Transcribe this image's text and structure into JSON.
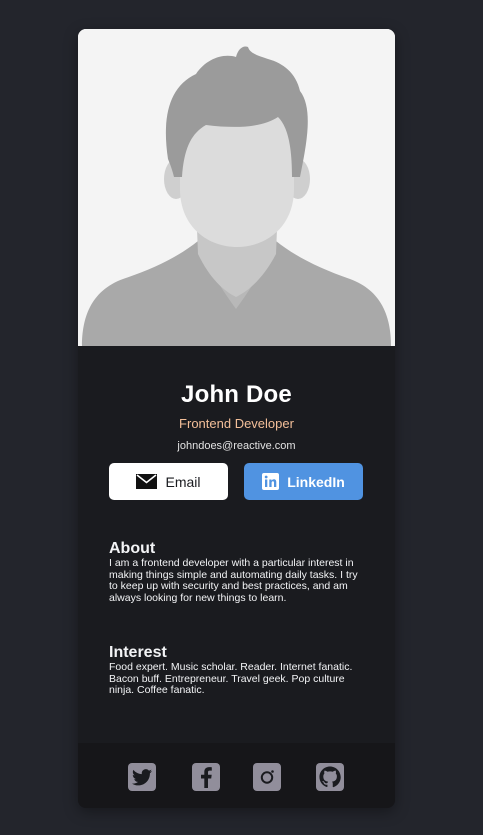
{
  "profile": {
    "name": "John Doe",
    "title": "Frontend Developer",
    "email": "johndoes@reactive.com"
  },
  "buttons": {
    "email_label": "Email",
    "linkedin_label": "LinkedIn"
  },
  "about": {
    "heading": "About",
    "text": "I am a frontend developer with a particular interest in making things simple and automating daily tasks. I try to keep up with security and best practices, and am always looking for new things to learn."
  },
  "interest": {
    "heading": "Interest",
    "text": "Food expert. Music scholar. Reader. Internet fanatic. Bacon buff. Entrepreneur. Travel geek. Pop culture ninja. Coffee fanatic."
  },
  "footer": {
    "icons": [
      "twitter-icon",
      "facebook-icon",
      "instagram-icon",
      "github-icon"
    ]
  },
  "colors": {
    "background": "#23252c",
    "card": "#1a1b1f",
    "footer": "#161619",
    "accent": "#f3bf99",
    "linkedin": "#5093e1",
    "social_icon": "#918e9b"
  }
}
